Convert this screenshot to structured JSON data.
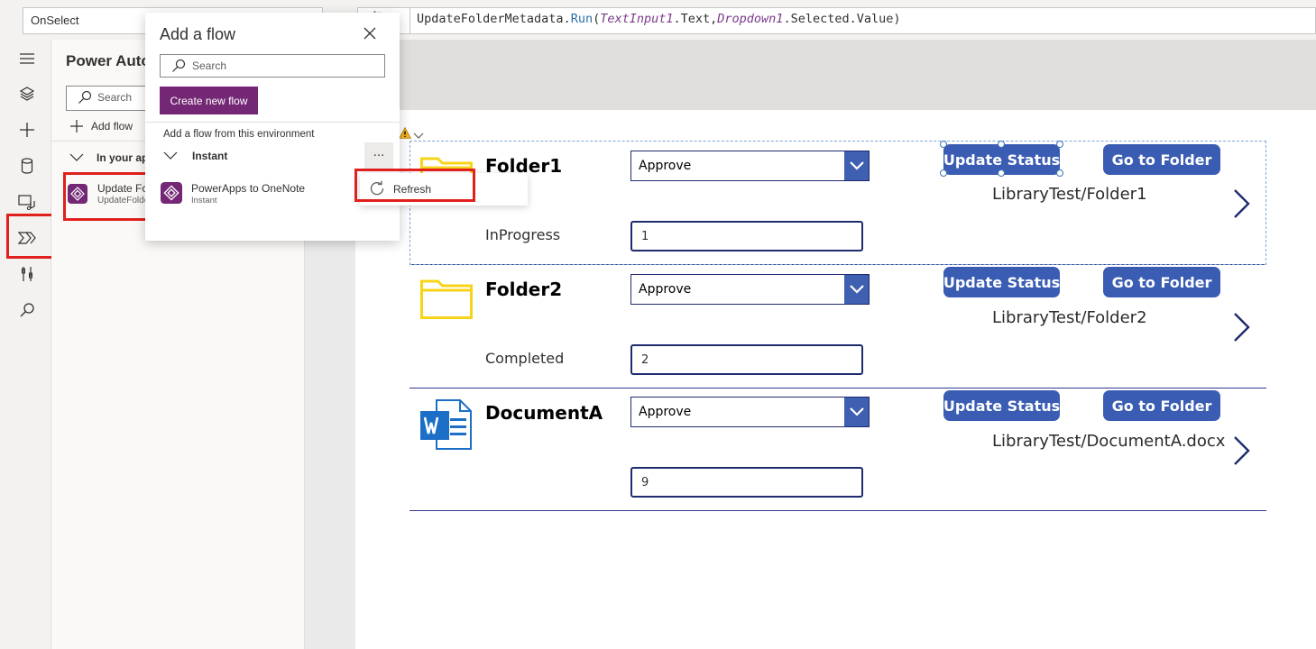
{
  "formula": {
    "property": "OnSelect",
    "fx_icon": "fx-icon",
    "prefix": "UpdateFolderMetadata.",
    "fn": "Run",
    "open": "(",
    "ctl1": "TextInput1",
    "mid": ".Text,",
    "ctl2": "Dropdown1",
    "tail": ".Selected.Value)"
  },
  "rail": {
    "icons": [
      "hamburger-icon",
      "layers-icon",
      "plus-icon",
      "database-icon",
      "media-icon",
      "power-automate-icon",
      "tools-icon",
      "search-icon"
    ],
    "selected": "power-automate-icon"
  },
  "panel": {
    "title": "Power Auto",
    "search_placeholder": "Search",
    "add_flow": "Add flow",
    "section": "In your ap",
    "flow_name": "Update Fo",
    "flow_sub": "UpdateFolde"
  },
  "dialog": {
    "title": "Add a flow",
    "search_placeholder": "Search",
    "create_button": "Create new flow",
    "env_label": "Add a flow from this environment",
    "group": "Instant",
    "more": "···",
    "flow_name": "PowerApps to OneNote",
    "flow_type": "Instant",
    "menu_refresh": "Refresh"
  },
  "gallery": {
    "items": [
      {
        "title": "Folder1",
        "icon": "folder-icon",
        "status": "InProgress",
        "dropdown": "Approve",
        "input": "1",
        "update_btn": "Update Status",
        "goto_btn": "Go to Folder",
        "path": "LibraryTest/Folder1"
      },
      {
        "title": "Folder2",
        "icon": "folder-icon",
        "status": "Completed",
        "dropdown": "Approve",
        "input": "2",
        "update_btn": "Update Status",
        "goto_btn": "Go to Folder",
        "path": "LibraryTest/Folder2"
      },
      {
        "title": "DocumentA",
        "icon": "word-icon",
        "status": "",
        "dropdown": "Approve",
        "input": "9",
        "update_btn": "Update Status",
        "goto_btn": "Go to Folder",
        "path": "LibraryTest/DocumentA.docx"
      }
    ]
  },
  "colors": {
    "accent_purple": "#742774",
    "button_blue": "#3a5db3",
    "highlight_red": "#e0201c",
    "folder_yellow": "#f7d417"
  }
}
